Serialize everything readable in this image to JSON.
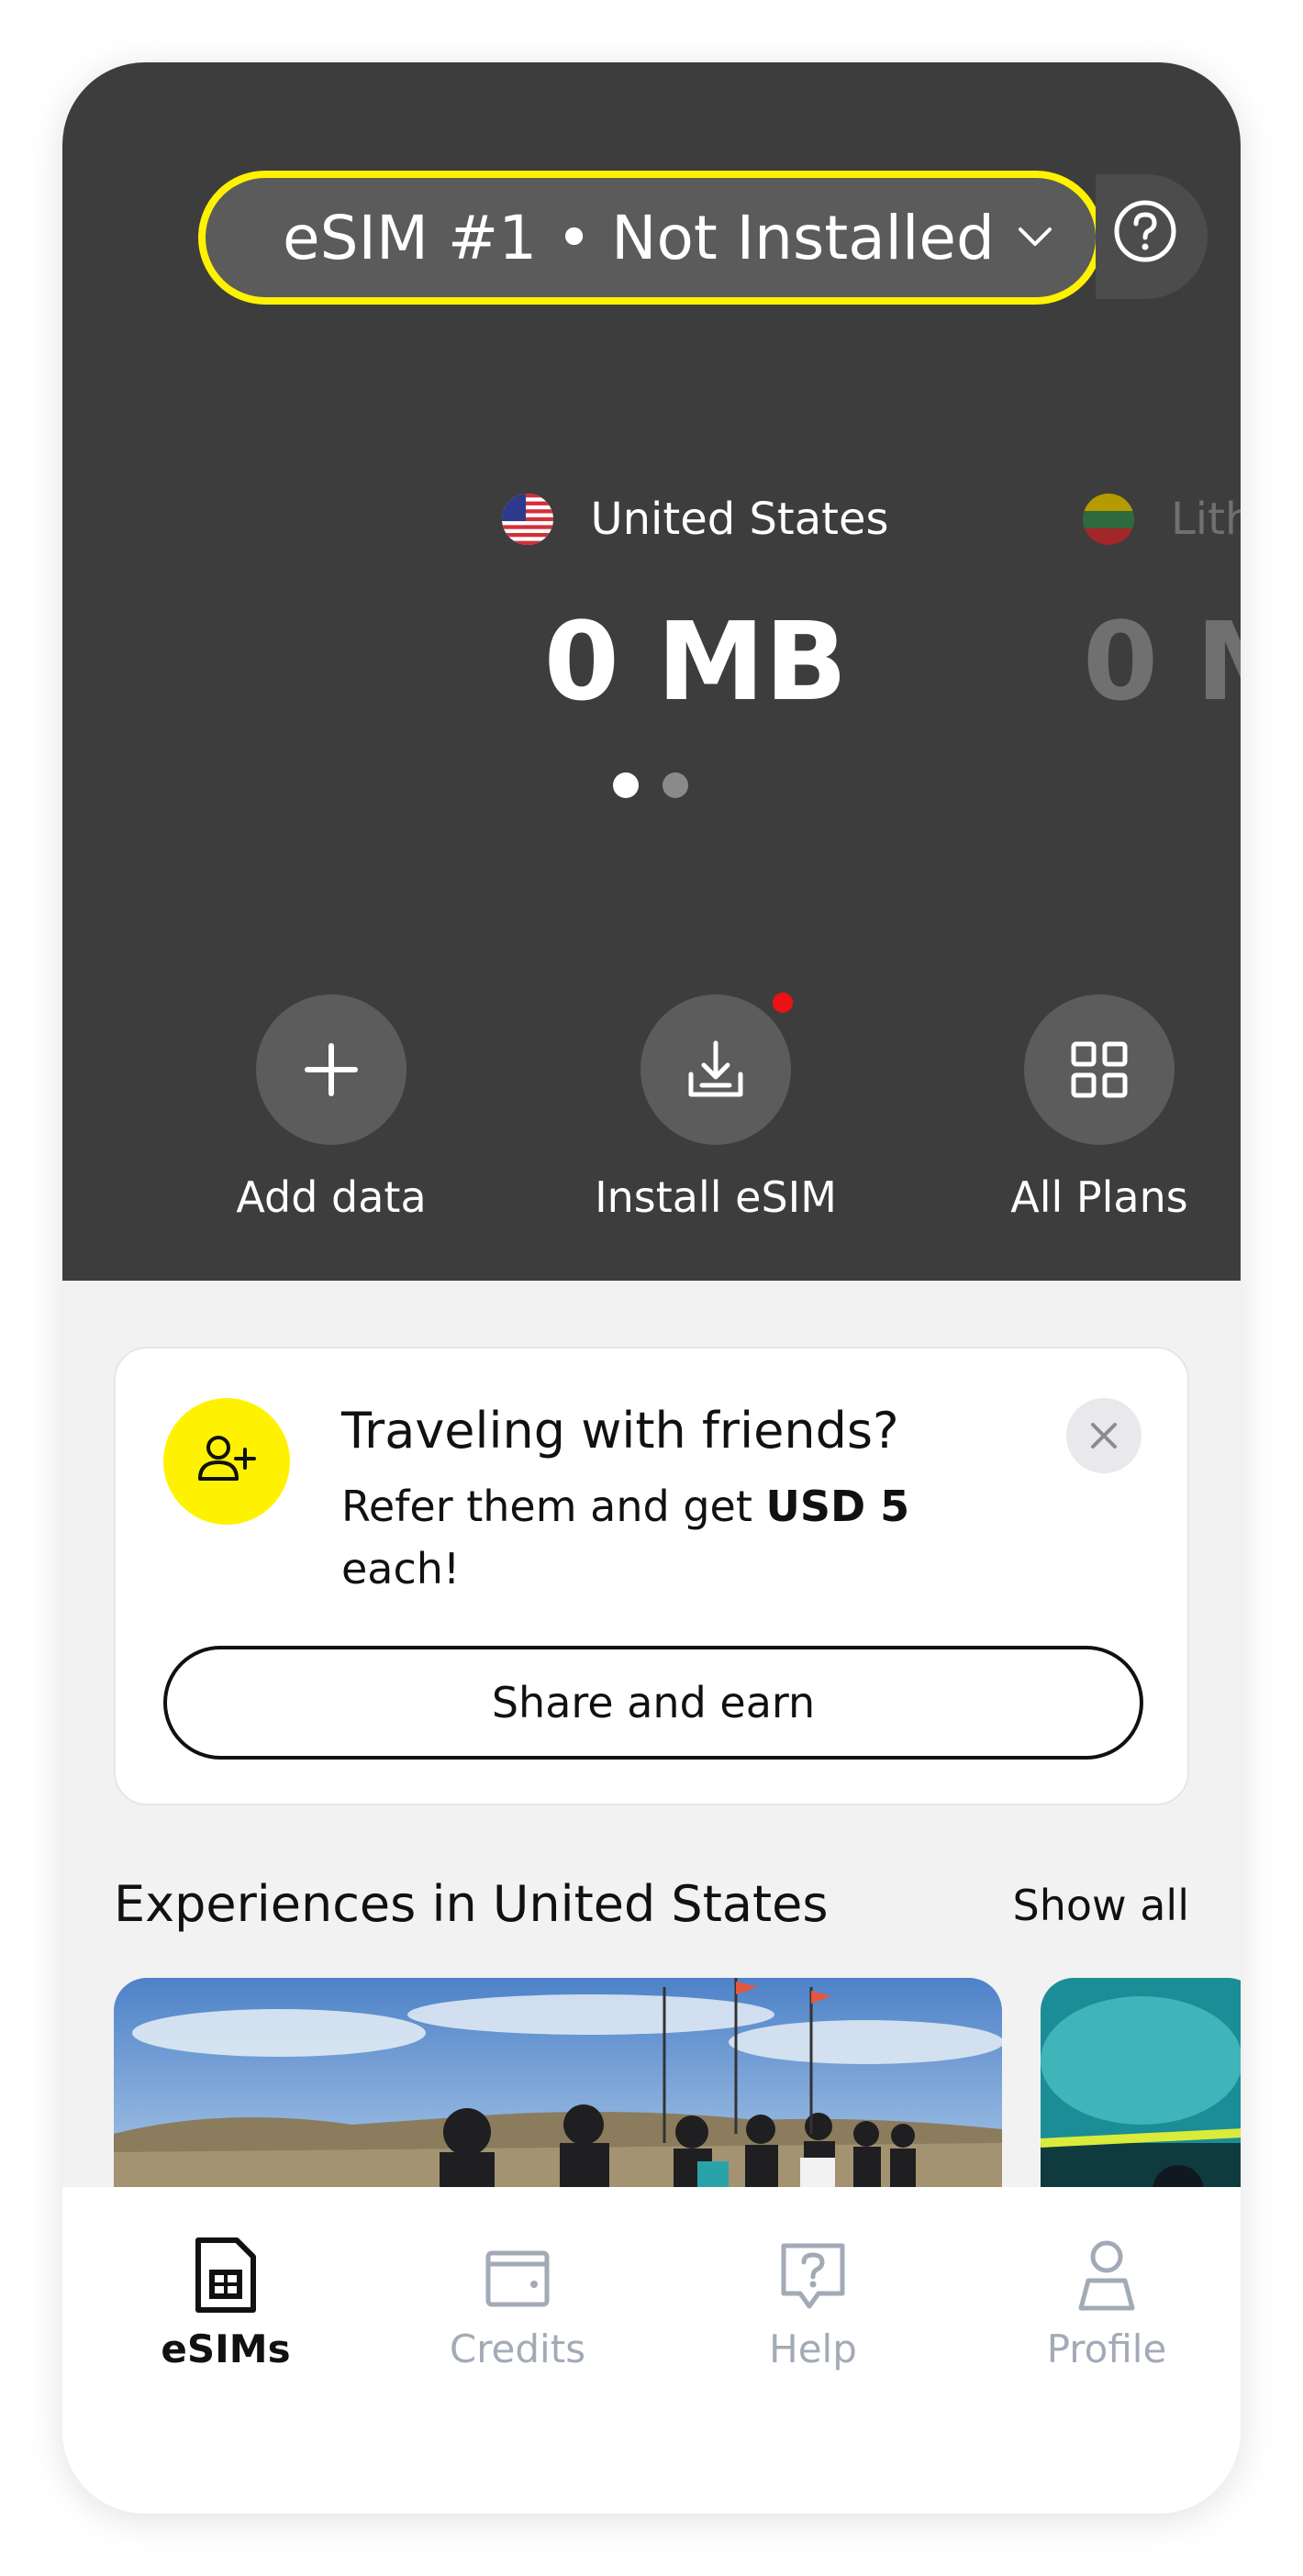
{
  "header": {
    "esim_selector_label": "eSIM #1 • Not Installed"
  },
  "plans": [
    {
      "country": "United States",
      "data_remaining": "0 MB",
      "flag_icon": "us-flag-icon"
    },
    {
      "country": "Lith",
      "data_remaining": "0 M",
      "flag_icon": "lithuania-flag-icon"
    }
  ],
  "carousel": {
    "page_count": 2,
    "active_index": 0
  },
  "actions": [
    {
      "label": "Add data",
      "icon": "plus-icon"
    },
    {
      "label": "Install eSIM",
      "icon": "download-icon",
      "has_notification": true
    },
    {
      "label": "All Plans",
      "icon": "grid-icon"
    }
  ],
  "referral": {
    "title": "Traveling with friends?",
    "body_prefix": "Refer them and get ",
    "amount_bold": "USD 5",
    "body_suffix": " each!",
    "button_label": "Share and earn",
    "icon": "add-user-icon"
  },
  "experiences": {
    "title": "Experiences in United States",
    "show_all_label": "Show all"
  },
  "tabbar": {
    "active": "eSIMs",
    "tabs": [
      {
        "label": "eSIMs",
        "icon": "sim-card-icon"
      },
      {
        "label": "Credits",
        "icon": "wallet-icon"
      },
      {
        "label": "Help",
        "icon": "help-icon"
      },
      {
        "label": "Profile",
        "icon": "profile-icon"
      }
    ]
  },
  "colors": {
    "accent_yellow": "#fff200",
    "header_bg": "#3d3d3d",
    "notification_red": "#ee1111",
    "inactive_tab": "#a3aab7"
  }
}
